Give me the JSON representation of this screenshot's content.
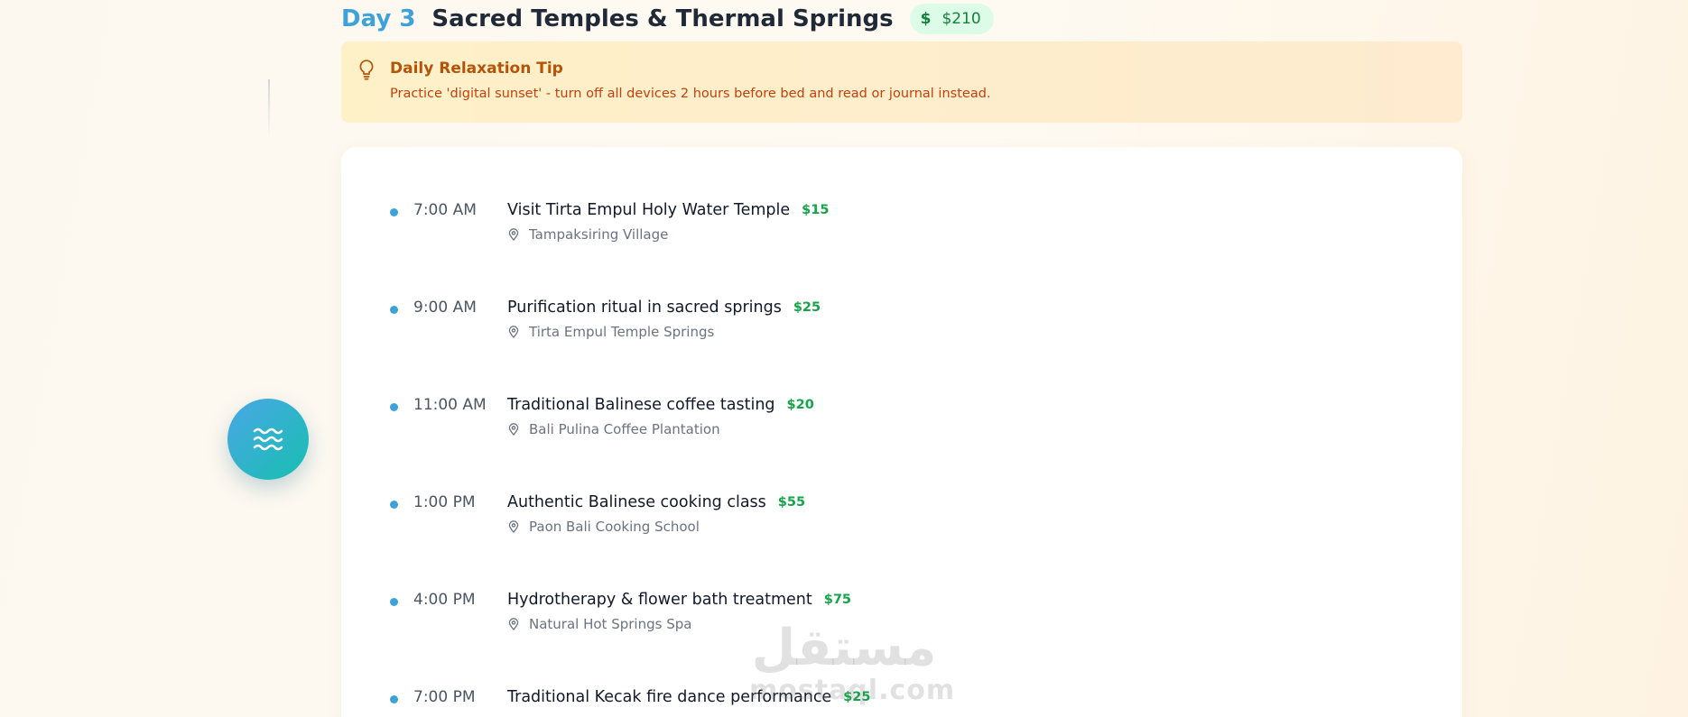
{
  "day": {
    "label": "Day 3",
    "title": "Sacred Temples & Thermal Springs",
    "cost": "$210",
    "cost_icon": "dollar-icon"
  },
  "tip": {
    "icon": "lightbulb-icon",
    "title": "Daily Relaxation Tip",
    "text": "Practice 'digital sunset' - turn off all devices 2 hours before bed and read or journal instead."
  },
  "fab": {
    "icon": "waves-icon"
  },
  "activities": [
    {
      "time": "7:00 AM",
      "title": "Visit Tirta Empul Holy Water Temple",
      "cost": "$15",
      "location": "Tampaksiring Village"
    },
    {
      "time": "9:00 AM",
      "title": "Purification ritual in sacred springs",
      "cost": "$25",
      "location": "Tirta Empul Temple Springs"
    },
    {
      "time": "11:00 AM",
      "title": "Traditional Balinese coffee tasting",
      "cost": "$20",
      "location": "Bali Pulina Coffee Plantation"
    },
    {
      "time": "1:00 PM",
      "title": "Authentic Balinese cooking class",
      "cost": "$55",
      "location": "Paon Bali Cooking School"
    },
    {
      "time": "4:00 PM",
      "title": "Hydrotherapy & flower bath treatment",
      "cost": "$75",
      "location": "Natural Hot Springs Spa"
    },
    {
      "time": "7:00 PM",
      "title": "Traditional Kecak fire dance performance",
      "cost": "$25",
      "location": ""
    }
  ],
  "watermark": {
    "arabic": "مستقل",
    "latin": "mostaql.com"
  },
  "colors": {
    "accent_blue": "#3ea2d8",
    "cost_green": "#16a34a",
    "tip_title": "#b45309",
    "tip_text": "#c2410c",
    "tip_bg": "#fef0c7"
  }
}
